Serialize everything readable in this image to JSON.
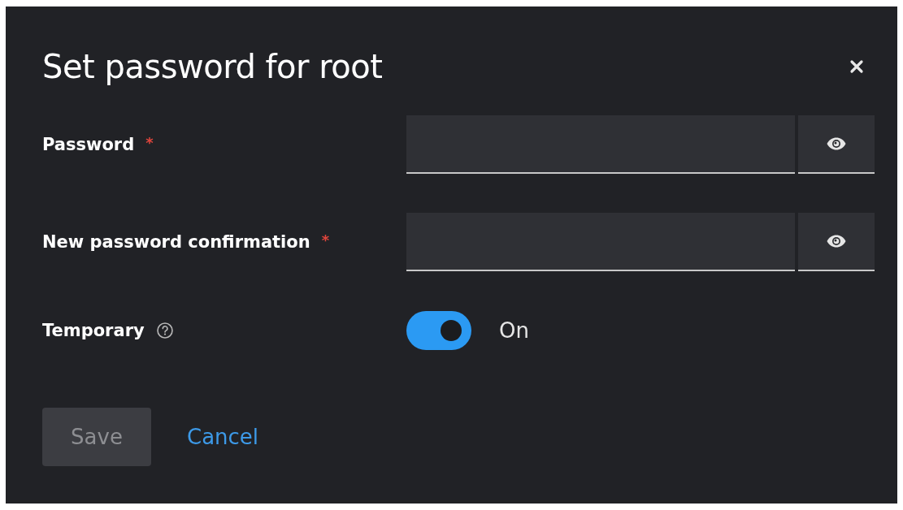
{
  "dialog": {
    "title": "Set password for root"
  },
  "fields": [
    {
      "kind": "password",
      "label": "Password",
      "required": true
    },
    {
      "kind": "password",
      "label": "New password confirmation",
      "required": true
    },
    {
      "kind": "switch",
      "label": "Temporary",
      "help": true,
      "on": true,
      "state_label": "On"
    }
  ],
  "required_mark": "*",
  "buttons": [
    {
      "kind": "primary",
      "label": "Save",
      "disabled": true
    },
    {
      "kind": "link",
      "label": "Cancel",
      "disabled": false
    }
  ]
}
